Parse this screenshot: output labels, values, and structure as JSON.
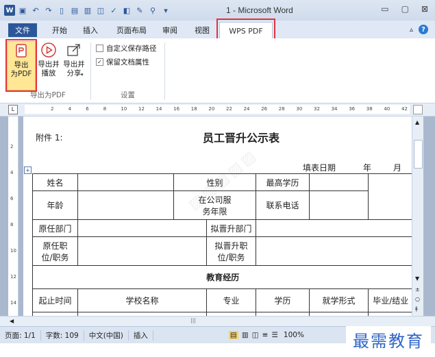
{
  "window": {
    "title": "1 - Microsoft Word",
    "minimize": "▭",
    "maximize": "▢",
    "close": "⊠"
  },
  "tabs": [
    "文件",
    "开始",
    "插入",
    "页面布局",
    "审阅",
    "视图",
    "WPS PDF"
  ],
  "ribbon": {
    "export_pdf": "导出\n为PDF",
    "export_play": "导出并\n播放",
    "export_share": "导出并\n分享",
    "group_export": "导出为PDF",
    "custom_path": "自定义保存路径",
    "keep_props": "保留文档属性",
    "group_settings": "设置"
  },
  "ruler_numbers": [
    "2",
    "4",
    "6",
    "8",
    "10",
    "12",
    "14",
    "16",
    "18",
    "20",
    "22",
    "24",
    "26",
    "28",
    "30",
    "32",
    "34",
    "36",
    "38",
    "40",
    "42"
  ],
  "vruler_numbers": [
    "2",
    "4",
    "6",
    "8",
    "10",
    "12",
    "14"
  ],
  "document": {
    "fujian": "附件 1:",
    "title": "员工晋升公示表",
    "fill_date": "填表日期",
    "year": "年",
    "month": "月",
    "watermark": "最需教育",
    "table": {
      "name": "姓名",
      "gender": "性别",
      "education": "最高学历",
      "age": "年龄",
      "service_years": "在公司服务年限",
      "phone": "联系电话",
      "orig_dept": "原任部门",
      "prop_dept": "拟晋升部门",
      "orig_post": "原任职位/职务",
      "prop_post": "拟晋升职位/职务",
      "edu_history": "教育经历",
      "start_end": "起止时间",
      "school": "学校名称",
      "major": "专业",
      "degree": "学历",
      "study_form": "就学形式",
      "graduate": "毕业/结业"
    }
  },
  "status": {
    "page": "页面: 1/1",
    "words": "字数: 109",
    "lang": "中文(中国)",
    "insert": "插入",
    "zoom": "100%"
  }
}
